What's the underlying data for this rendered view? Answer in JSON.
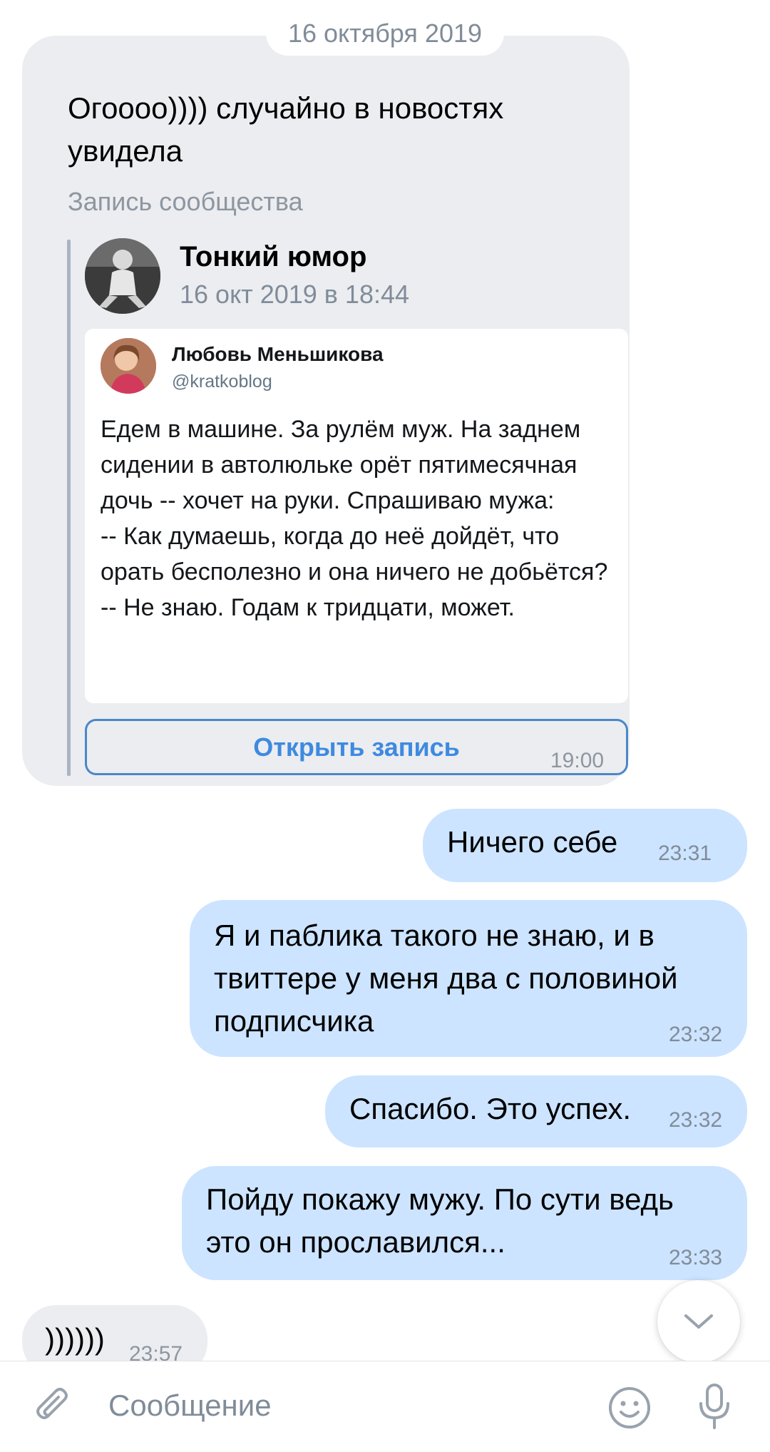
{
  "date_separator": "16 октября 2019",
  "incoming_message": {
    "text": "Огоооо)))) случайно в новостях увидела",
    "repost_label": "Запись сообщества",
    "group": {
      "name": "Тонкий юмор",
      "date": "16 окт 2019 в 18:44"
    },
    "tweet": {
      "author": "Любовь Меньшикова",
      "handle": "@kratkoblog",
      "body": "Едем в машине. За рулём муж. На заднем сидении в автолюльке орёт пятимесячная дочь -- хочет на руки. Спрашиваю мужа:\n-- Как думаешь, когда до неё дойдёт, что орать бесполезно и она ничего не добьётся?\n-- Не знаю. Годам к тридцати, может."
    },
    "open_button_label": "Открыть запись",
    "time": "19:00"
  },
  "outgoing_messages": [
    {
      "text": "Ничего себе",
      "time": "23:31"
    },
    {
      "text": "Я и паблика такого не знаю, и в\nтвиттере у меня два с половиной\nподписчика",
      "time": "23:32"
    },
    {
      "text": "Спасибо. Это успех.",
      "time": "23:32"
    },
    {
      "text": "Пойду покажу мужу. По сути ведь\nэто он прославился...",
      "time": "23:33"
    }
  ],
  "last_incoming": {
    "text": "))))))",
    "time": "23:57"
  },
  "composer": {
    "placeholder": "Сообщение",
    "attach_icon": "paperclip-icon",
    "emoji_icon": "smile-icon",
    "mic_icon": "microphone-icon"
  },
  "colors": {
    "incoming_bubble": "#ebedf0",
    "outgoing_bubble": "#cce4ff",
    "accent": "#3f8ae0"
  }
}
